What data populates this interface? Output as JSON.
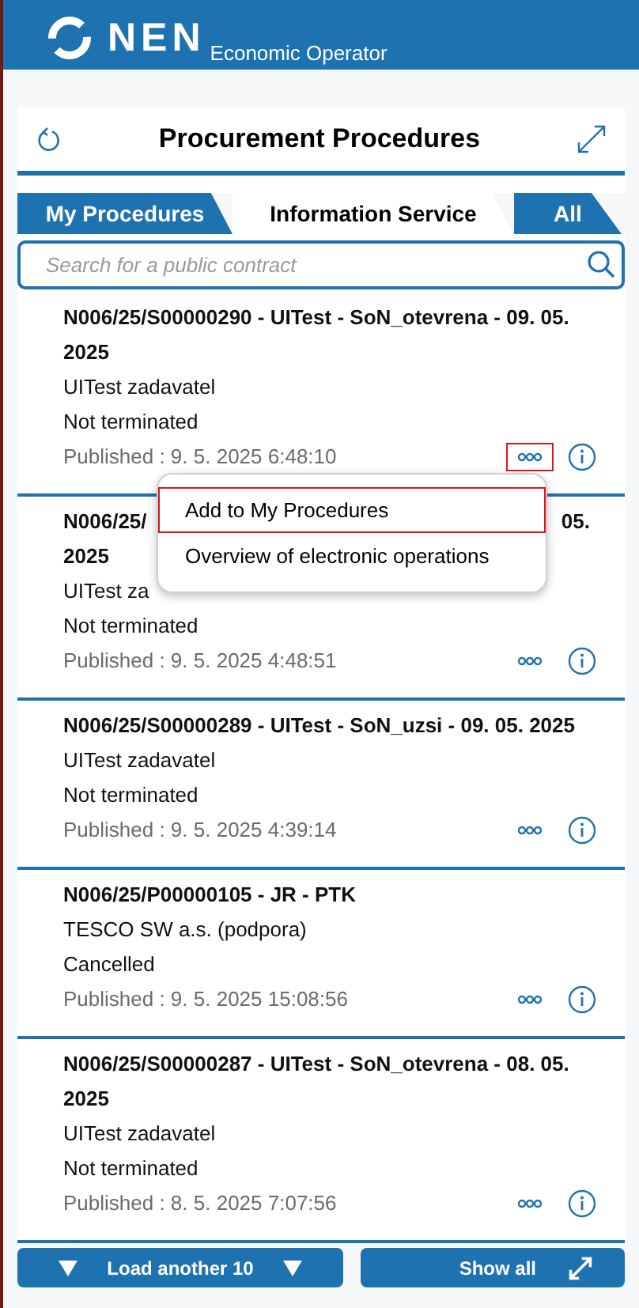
{
  "header": {
    "logo_text": "NEN",
    "subtitle": "Economic Operator"
  },
  "panel": {
    "title": "Procurement Procedures"
  },
  "tabs": [
    {
      "label": "My Procedures",
      "selected": false
    },
    {
      "label": "Information Service",
      "selected": true
    },
    {
      "label": "All",
      "selected": false
    }
  ],
  "search": {
    "placeholder": "Search for a public contract"
  },
  "rows": [
    {
      "kind": "full",
      "title": "N006/25/S00000290 - UITest - SoN_otevrena - 09. 05. 2025",
      "buyer": "UITest zadavatel",
      "status": "Not terminated",
      "published": "Published : 9. 5. 2025 6:48:10",
      "more_highlighted": true
    },
    {
      "kind": "covered",
      "title_start": "N006/25/",
      "title_end": "05.",
      "title_line2": "2025",
      "buyer": "UITest za",
      "status": "Not terminated",
      "published": "Published : 9. 5. 2025 4:48:51",
      "more_highlighted": false
    },
    {
      "kind": "full",
      "title": "N006/25/S00000289 - UITest - SoN_uzsi - 09. 05. 2025",
      "buyer": "UITest zadavatel",
      "status": "Not terminated",
      "published": "Published : 9. 5. 2025 4:39:14",
      "more_highlighted": false
    },
    {
      "kind": "full",
      "title": "N006/25/P00000105 - JR - PTK",
      "buyer": "TESCO SW a.s. (podpora)",
      "status": "Cancelled",
      "published": "Published : 9. 5. 2025 15:08:56",
      "more_highlighted": false
    },
    {
      "kind": "full",
      "title": "N006/25/S00000287 - UITest - SoN_otevrena - 08. 05. 2025",
      "buyer": "UITest zadavatel",
      "status": "Not terminated",
      "published": "Published : 8. 5. 2025 7:07:56",
      "more_highlighted": false
    }
  ],
  "context_menu": {
    "items": [
      {
        "label": "Add to My Procedures",
        "highlighted": true
      },
      {
        "label": "Overview of electronic operations",
        "highlighted": false
      }
    ]
  },
  "footer": {
    "load_more": "Load another 10",
    "show_all": "Show all"
  }
}
